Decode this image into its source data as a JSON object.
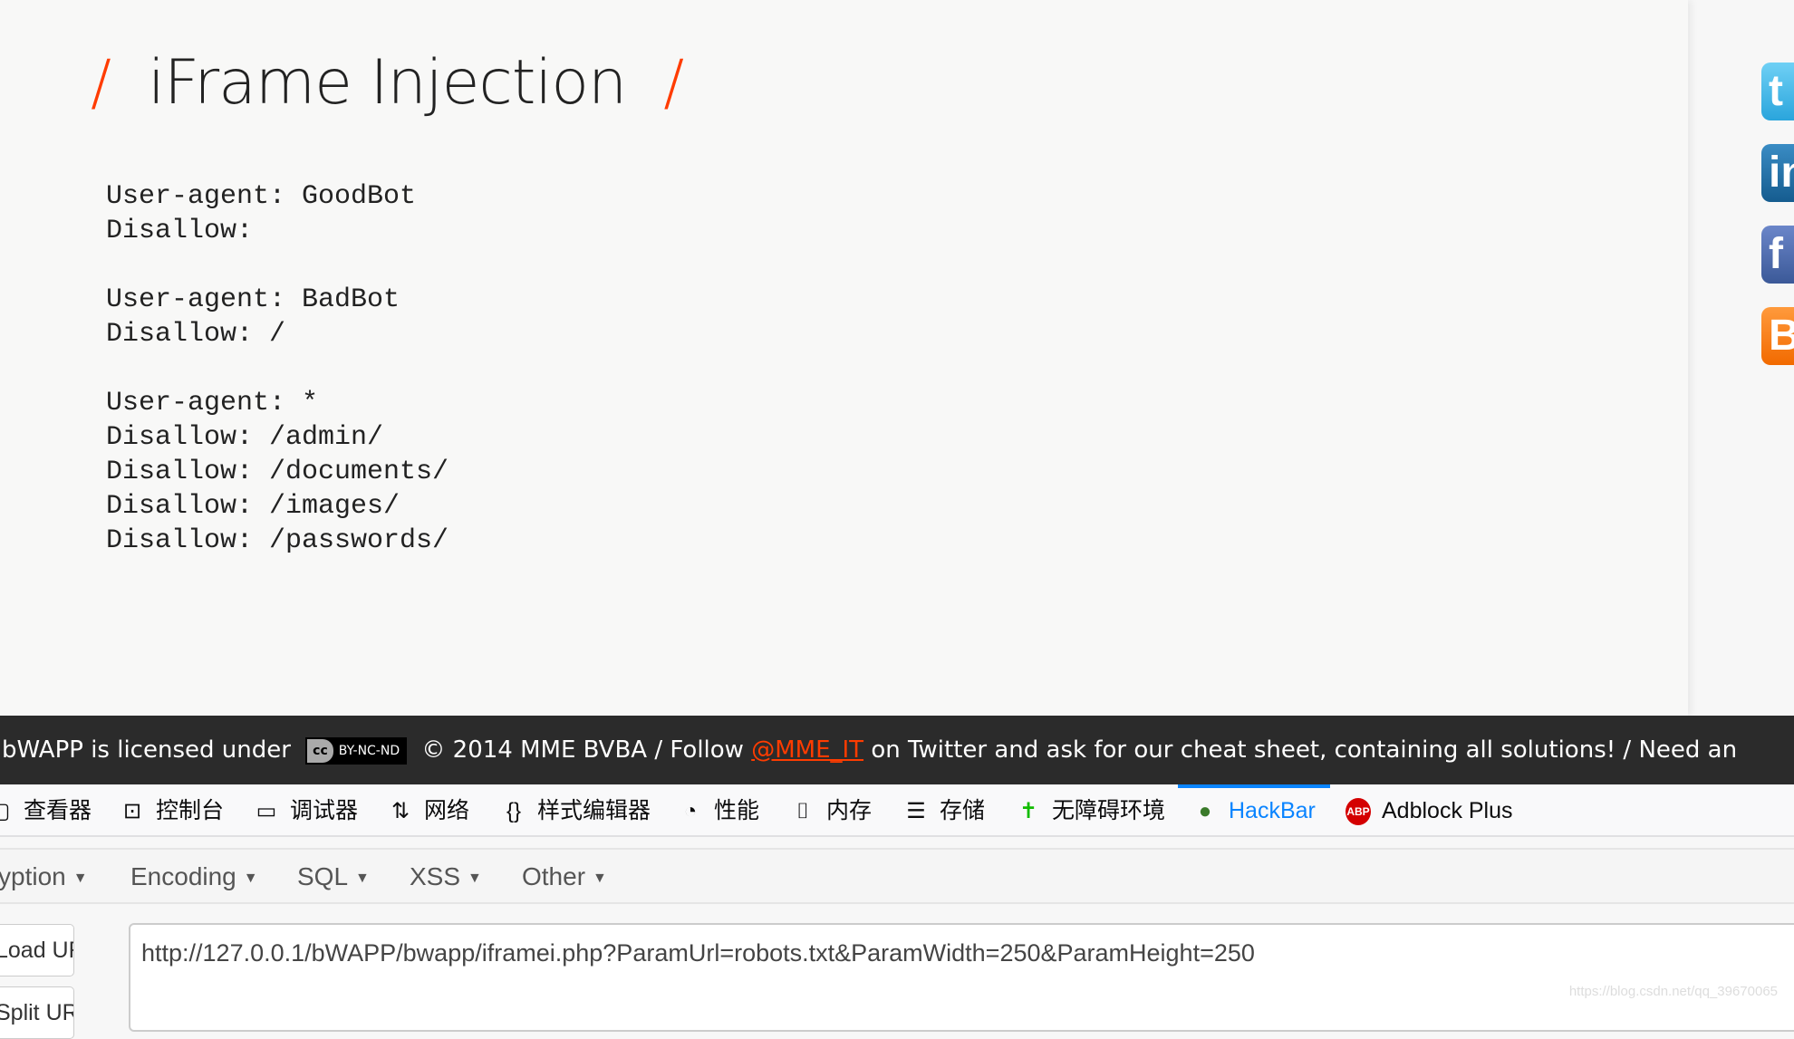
{
  "page": {
    "title": "iFrame Injection",
    "title_slash": "/",
    "robots_lines": [
      "User-agent: GoodBot",
      "Disallow:",
      "",
      "User-agent: BadBot",
      "Disallow: /",
      "",
      "User-agent: *",
      "Disallow: /admin/",
      "Disallow: /documents/",
      "Disallow: /images/",
      "Disallow: /passwords/"
    ]
  },
  "social": [
    {
      "icon": "twitter-icon",
      "color": "#3bb4e6"
    },
    {
      "icon": "linkedin-icon",
      "color": "#1b6ea8"
    },
    {
      "icon": "facebook-icon",
      "color": "#3b5998"
    },
    {
      "icon": "blogger-icon",
      "color": "#f57d00"
    }
  ],
  "footer": {
    "prefix": "bWAPP is licensed under",
    "cc_badge": "BY-NC-ND",
    "cc_logo": "cc",
    "middle": "© 2014 MME BVBA / Follow",
    "link": "@MME_IT",
    "suffix": "on Twitter and ask for our cheat sheet, containing all solutions! / Need an"
  },
  "devtools": {
    "tabs": [
      {
        "label": "查看器"
      },
      {
        "label": "控制台"
      },
      {
        "label": "调试器"
      },
      {
        "label": "网络"
      },
      {
        "label": "样式编辑器"
      },
      {
        "label": "性能"
      },
      {
        "label": "内存"
      },
      {
        "label": "存储"
      },
      {
        "label": "无障碍环境"
      },
      {
        "label": "HackBar",
        "active": true
      },
      {
        "label": "Adblock Plus"
      }
    ],
    "accent": "#0a84ff"
  },
  "hackbar": {
    "menus": [
      "yption",
      "Encoding",
      "SQL",
      "XSS",
      "Other"
    ],
    "load_url": "Load URL",
    "split_url": "Split URL",
    "url": "http://127.0.0.1/bWAPP/bwapp/iframei.php?ParamUrl=robots.txt&ParamWidth=250&ParamHeight=250"
  },
  "watermark": "https://blog.csdn.net/qq_39670065"
}
